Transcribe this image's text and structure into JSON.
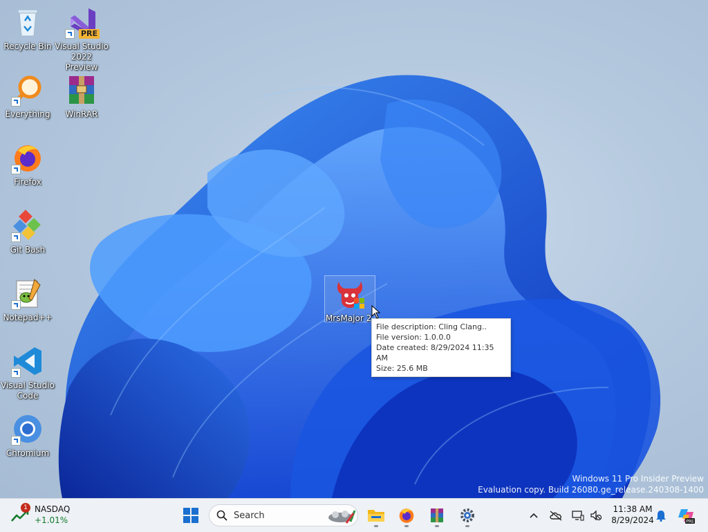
{
  "desktop": {
    "icons": [
      {
        "label": "Recycle Bin",
        "icon": "recycle-bin-icon"
      },
      {
        "label": "Visual Studio 2022 Preview",
        "icon": "visual-studio-icon",
        "badge": "PRE"
      },
      {
        "label": "Everything",
        "icon": "everything-search-icon"
      },
      {
        "label": "WinRAR",
        "icon": "winrar-icon"
      },
      {
        "label": "Firefox",
        "icon": "firefox-icon"
      },
      {
        "label": "Git Bash",
        "icon": "git-bash-icon"
      },
      {
        "label": "Notepad++",
        "icon": "notepad-plus-plus-icon"
      },
      {
        "label": "Visual Studio Code",
        "icon": "vscode-icon"
      },
      {
        "label": "Chromium",
        "icon": "chromium-icon"
      },
      {
        "label": "MrsMajor 2.",
        "icon": "mrsmajor-icon"
      }
    ],
    "tooltip": {
      "lines": [
        "File description: Cling Clang..",
        "File version: 1.0.0.0",
        "Date created: 8/29/2024 11:35 AM",
        "Size: 25.6 MB"
      ]
    },
    "watermark": {
      "line1": "Windows 11 Pro Insider Preview",
      "line2": "Evaluation copy. Build 26080.ge_release.240308-1400"
    }
  },
  "taskbar": {
    "widget": {
      "badge": "1",
      "ticker": "NASDAQ",
      "change": "+1.01%"
    },
    "search": {
      "label": "Search"
    },
    "apps": [
      "start-icon",
      "file-explorer-icon",
      "firefox-icon",
      "winrar-icon",
      "settings-icon"
    ],
    "clock": {
      "time": "11:38 AM",
      "date": "8/29/2024"
    },
    "colors": {
      "accent": "#1a6fd1",
      "background": "#eef1f5"
    }
  }
}
